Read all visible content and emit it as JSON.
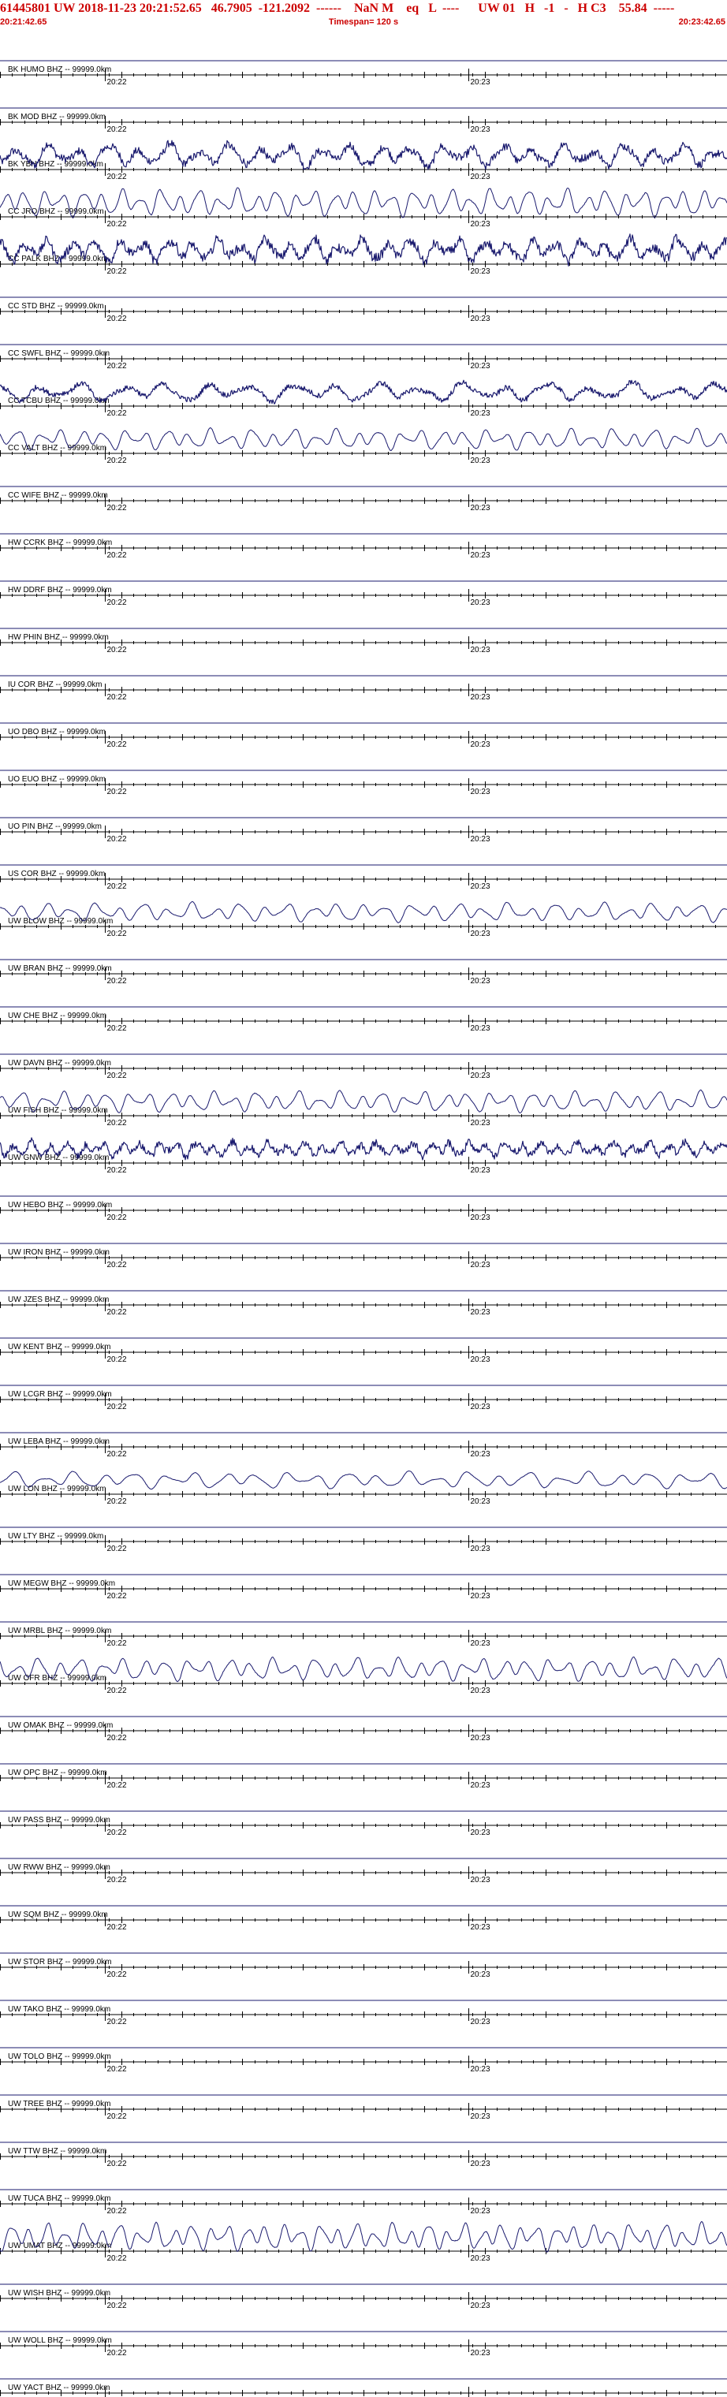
{
  "header": {
    "title": "61445801 UW 2018-11-23 20:21:52.65   46.7905  -121.2092  ------    NaN M    eq   L  ----      UW 01   H   -1   -   H C3    55.84  -----",
    "start_time": "20:21:42.65",
    "timespan": "Timespan= 120 s",
    "end_time": "20:23:42.65"
  },
  "colors": {
    "title": "#cc0000",
    "trace": "#1a1a6e",
    "axis": "#000000"
  },
  "chart_data": {
    "type": "line",
    "x_unit": "s",
    "x_range": [
      0,
      120
    ],
    "time_ticks": [
      {
        "label": "20:22",
        "t": 17.35
      },
      {
        "label": "20:23",
        "t": 77.35
      }
    ],
    "traces": [
      {
        "label": "BK HUMO BHZ -- 99999.0km",
        "amp": 0,
        "period": 0
      },
      {
        "label": "BK MOD BHZ -- 99999.0km",
        "amp": 0,
        "period": 0
      },
      {
        "label": "BK YBH BHZ -- 99999.0km",
        "amp": 22,
        "period": 5,
        "noise": 0.6
      },
      {
        "label": "CC JRO BHZ -- 99999.0km",
        "amp": 26,
        "period": 3.2,
        "noise": 0.05
      },
      {
        "label": "CC PALK BHZ -- 99999.0km",
        "amp": 22,
        "period": 4,
        "noise": 0.7
      },
      {
        "label": "CC STD BHZ -- 99999.0km",
        "amp": 0,
        "period": 0
      },
      {
        "label": "CC SWFL BHZ -- 99999.0km",
        "amp": 0,
        "period": 0
      },
      {
        "label": "CC TCBU BHZ -- 99999.0km",
        "amp": 18,
        "period": 7,
        "noise": 0.5
      },
      {
        "label": "CC VALT BHZ -- 99999.0km",
        "amp": 20,
        "period": 3.5,
        "noise": 0.05
      },
      {
        "label": "CC WIFE BHZ -- 99999.0km",
        "amp": 0,
        "period": 0
      },
      {
        "label": "HW CCRK BHZ -- 99999.0km",
        "amp": 0,
        "period": 0
      },
      {
        "label": "HW DDRF BHZ -- 99999.0km",
        "amp": 0,
        "period": 0
      },
      {
        "label": "HW PHIN BHZ -- 99999.0km",
        "amp": 0,
        "period": 0
      },
      {
        "label": "IU COR BHZ -- 99999.0km",
        "amp": 0,
        "period": 0
      },
      {
        "label": "UO DBO BHZ -- 99999.0km",
        "amp": 0,
        "period": 0
      },
      {
        "label": "UO EUO BHZ -- 99999.0km",
        "amp": 0,
        "period": 0
      },
      {
        "label": "UO PIN BHZ -- 99999.0km",
        "amp": 0,
        "period": 0
      },
      {
        "label": "US COR BHZ -- 99999.0km",
        "amp": 0,
        "period": 0
      },
      {
        "label": "UW BLOW BHZ -- 99999.0km",
        "amp": 18,
        "period": 4,
        "noise": 0.05
      },
      {
        "label": "UW BRAN BHZ -- 99999.0km",
        "amp": 0,
        "period": 0
      },
      {
        "label": "UW CHE BHZ -- 99999.0km",
        "amp": 0,
        "period": 0
      },
      {
        "label": "UW DAVN BHZ -- 99999.0km",
        "amp": 0,
        "period": 0
      },
      {
        "label": "UW FISH BHZ -- 99999.0km",
        "amp": 20,
        "period": 3.5,
        "noise": 0.05
      },
      {
        "label": "UW GNW BHZ -- 99999.0km",
        "amp": 14,
        "period": 3,
        "noise": 0.9
      },
      {
        "label": "UW HEBO BHZ -- 99999.0km",
        "amp": 0,
        "period": 0
      },
      {
        "label": "UW IRON BHZ -- 99999.0km",
        "amp": 0,
        "period": 0
      },
      {
        "label": "UW JZES BHZ -- 99999.0km",
        "amp": 0,
        "period": 0
      },
      {
        "label": "UW KENT BHZ -- 99999.0km",
        "amp": 0,
        "period": 0
      },
      {
        "label": "UW LCGR BHZ -- 99999.0km",
        "amp": 0,
        "period": 0
      },
      {
        "label": "UW LEBA BHZ -- 99999.0km",
        "amp": 0,
        "period": 0
      },
      {
        "label": "UW LON BHZ -- 99999.0km",
        "amp": 16,
        "period": 5,
        "noise": 0.05
      },
      {
        "label": "UW LTY BHZ -- 99999.0km",
        "amp": 0,
        "period": 0
      },
      {
        "label": "UW MEGW BHZ -- 99999.0km",
        "amp": 0,
        "period": 0
      },
      {
        "label": "UW MRBL BHZ -- 99999.0km",
        "amp": 0,
        "period": 0
      },
      {
        "label": "UW OFR BHZ -- 99999.0km",
        "amp": 22,
        "period": 3.5,
        "noise": 0.05
      },
      {
        "label": "UW OMAK BHZ -- 99999.0km",
        "amp": 0,
        "period": 0
      },
      {
        "label": "UW OPC BHZ -- 99999.0km",
        "amp": 0,
        "period": 0
      },
      {
        "label": "UW PASS BHZ -- 99999.0km",
        "amp": 0,
        "period": 0
      },
      {
        "label": "UW RWW BHZ -- 99999.0km",
        "amp": 0,
        "period": 0
      },
      {
        "label": "UW SQM BHZ -- 99999.0km",
        "amp": 0,
        "period": 0
      },
      {
        "label": "UW STOR BHZ -- 99999.0km",
        "amp": 0,
        "period": 0
      },
      {
        "label": "UW TAKO BHZ -- 99999.0km",
        "amp": 0,
        "period": 0
      },
      {
        "label": "UW TOLO BHZ -- 99999.0km",
        "amp": 0,
        "period": 0
      },
      {
        "label": "UW TREE BHZ -- 99999.0km",
        "amp": 0,
        "period": 0
      },
      {
        "label": "UW TTW BHZ -- 99999.0km",
        "amp": 0,
        "period": 0
      },
      {
        "label": "UW TUCA BHZ -- 99999.0km",
        "amp": 0,
        "period": 0
      },
      {
        "label": "UW UMAT BHZ -- 99999.0km",
        "amp": 26,
        "period": 3,
        "noise": 0.05
      },
      {
        "label": "UW WISH BHZ -- 99999.0km",
        "amp": 0,
        "period": 0
      },
      {
        "label": "UW WOLL BHZ -- 99999.0km",
        "amp": 0,
        "period": 0
      },
      {
        "label": "UW YACT BHZ -- 99999.0km",
        "amp": 0,
        "period": 0
      }
    ]
  }
}
